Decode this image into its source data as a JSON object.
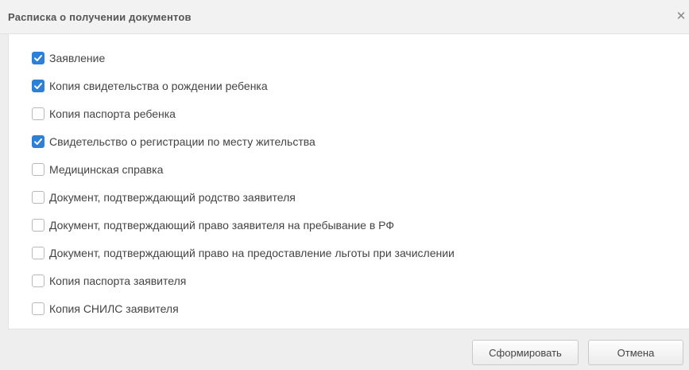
{
  "dialog": {
    "title": "Расписка о получении документов",
    "close_symbol": "✕"
  },
  "documents": [
    {
      "label": "Заявление",
      "checked": true
    },
    {
      "label": "Копия свидетельства о рождении ребенка",
      "checked": true
    },
    {
      "label": "Копия паспорта ребенка",
      "checked": false
    },
    {
      "label": "Свидетельство о регистрации по месту жительства",
      "checked": true
    },
    {
      "label": "Медицинская справка",
      "checked": false
    },
    {
      "label": "Документ, подтверждающий родство заявителя",
      "checked": false
    },
    {
      "label": "Документ, подтверждающий право заявителя на пребывание в РФ",
      "checked": false
    },
    {
      "label": "Документ, подтверждающий право на предоставление льготы при зачислении",
      "checked": false
    },
    {
      "label": "Копия паспорта заявителя",
      "checked": false
    },
    {
      "label": "Копия СНИЛС заявителя",
      "checked": false
    }
  ],
  "buttons": {
    "form": "Сформировать",
    "cancel": "Отмена"
  },
  "colors": {
    "checkbox_checked": "#2e7fd6"
  }
}
